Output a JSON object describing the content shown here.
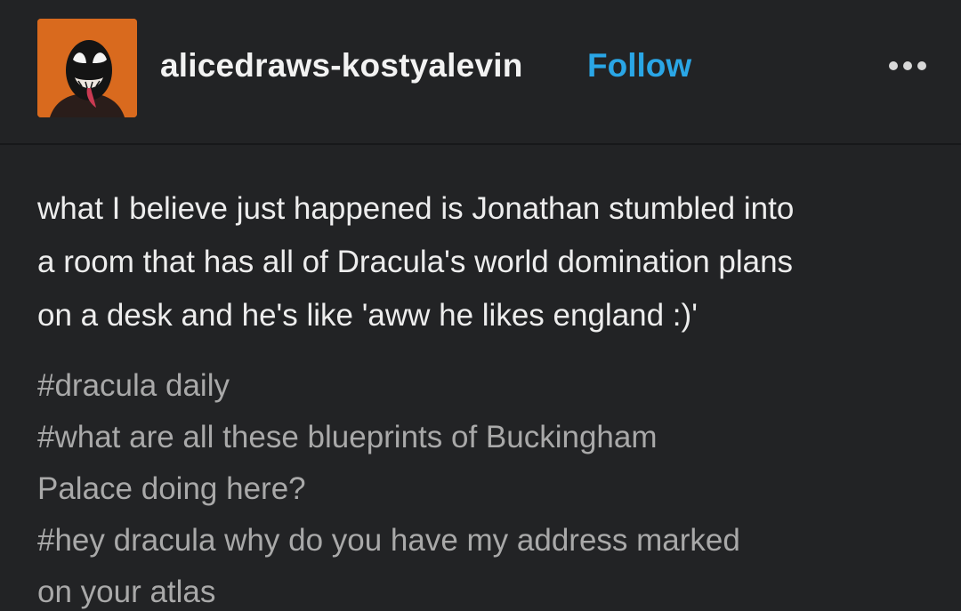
{
  "header": {
    "username": "alicedraws-kostyalevin",
    "follow_label": "Follow",
    "avatar_icon": "venom-mask-avatar",
    "more_icon": "ellipsis-icon"
  },
  "post": {
    "text": "what I believe just happened is Jonathan stumbled into\na room that has all of Dracula's world domination plans\non a desk and he's like 'aww he likes england :)'"
  },
  "tags": [
    "#dracula daily",
    "#what are all these blueprints of Buckingham\nPalace doing here?",
    "#hey dracula why do you have my address marked\non your atlas"
  ],
  "colors": {
    "background": "#222325",
    "text": "#ededed",
    "tag": "#a9a9a9",
    "follow": "#2aa6e6",
    "avatar_bg": "#d96a1e"
  }
}
